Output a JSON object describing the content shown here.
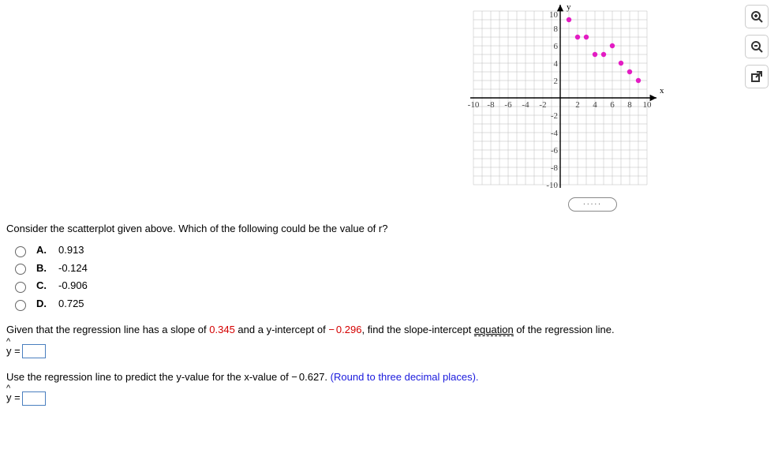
{
  "chart_data": {
    "type": "scatter",
    "xlabel": "x",
    "ylabel": "y",
    "xlim": [
      -10,
      10
    ],
    "ylim": [
      -10,
      10
    ],
    "x_ticks": [
      -10,
      -8,
      -6,
      -4,
      -2,
      2,
      4,
      6,
      8,
      10
    ],
    "y_ticks": [
      -10,
      -8,
      -6,
      -4,
      -2,
      2,
      4,
      6,
      8,
      10
    ],
    "points": [
      [
        1,
        9
      ],
      [
        2,
        7
      ],
      [
        3,
        7
      ],
      [
        4,
        5
      ],
      [
        5,
        5
      ],
      [
        6,
        6
      ],
      [
        7,
        4
      ],
      [
        8,
        3
      ],
      [
        9,
        2
      ]
    ]
  },
  "question1": {
    "prompt": "Consider the scatterplot given above. Which of the following could be the value of r?",
    "choices": [
      {
        "letter": "A.",
        "value": "0.913"
      },
      {
        "letter": "B.",
        "value": "-0.124"
      },
      {
        "letter": "C.",
        "value": "-0.906"
      },
      {
        "letter": "D.",
        "value": "0.725"
      }
    ]
  },
  "question2": {
    "prefix": "Given that the regression line has a slope of ",
    "slope": "0.345",
    "mid1": " and a y-intercept of ",
    "neg_sign": "−",
    "intercept": "0.296",
    "mid2": ", find the slope-intercept ",
    "linkword": "equation",
    "mid3": " of the regression line.",
    "lhs": "y = "
  },
  "question3": {
    "prefix": "Use the regression line to predict the y-value for the x-value of ",
    "neg_sign": "−",
    "xval": "0.627. ",
    "note": "(Round to three decimal places).",
    "lhs": "y = "
  },
  "tools": {
    "zoom_in": "zoom-in",
    "zoom_out": "zoom-out",
    "popout": "popout"
  },
  "ellipsis": "....."
}
